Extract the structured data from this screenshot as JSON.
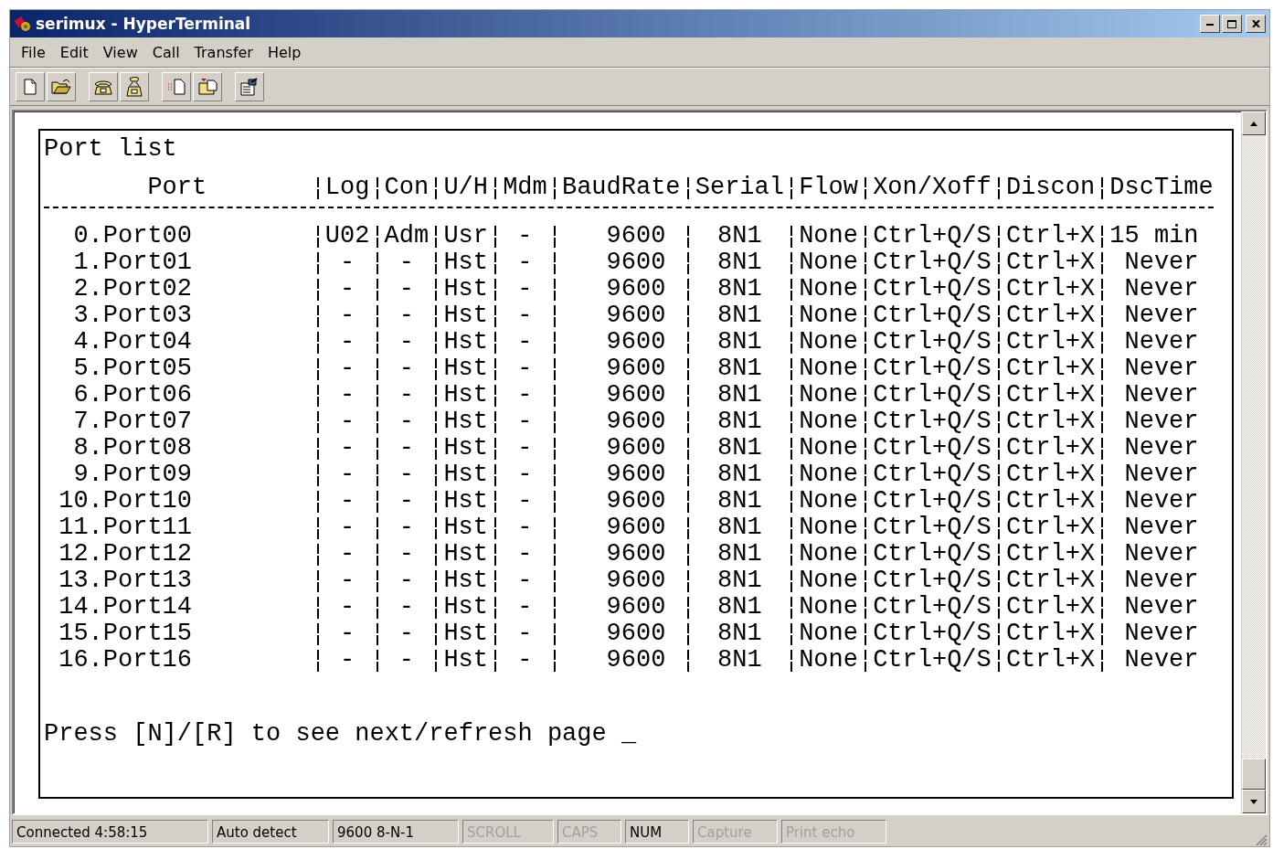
{
  "window": {
    "title": "serimux - HyperTerminal"
  },
  "menu": [
    "File",
    "Edit",
    "View",
    "Call",
    "Transfer",
    "Help"
  ],
  "terminal": {
    "title": "Port list",
    "columns": [
      "Port",
      "Log",
      "Con",
      "U/H",
      "Mdm",
      "BaudRate",
      "Serial",
      "Flow",
      "Xon/Xoff",
      "Discon",
      "DscTime"
    ],
    "rows": [
      [
        "0.Port00",
        "U02",
        "Adm",
        "Usr",
        "-",
        "9600",
        "8N1",
        "None",
        "Ctrl+Q/S",
        "Ctrl+X",
        "15 min"
      ],
      [
        "1.Port01",
        "-",
        "-",
        "Hst",
        "-",
        "9600",
        "8N1",
        "None",
        "Ctrl+Q/S",
        "Ctrl+X",
        "Never"
      ],
      [
        "2.Port02",
        "-",
        "-",
        "Hst",
        "-",
        "9600",
        "8N1",
        "None",
        "Ctrl+Q/S",
        "Ctrl+X",
        "Never"
      ],
      [
        "3.Port03",
        "-",
        "-",
        "Hst",
        "-",
        "9600",
        "8N1",
        "None",
        "Ctrl+Q/S",
        "Ctrl+X",
        "Never"
      ],
      [
        "4.Port04",
        "-",
        "-",
        "Hst",
        "-",
        "9600",
        "8N1",
        "None",
        "Ctrl+Q/S",
        "Ctrl+X",
        "Never"
      ],
      [
        "5.Port05",
        "-",
        "-",
        "Hst",
        "-",
        "9600",
        "8N1",
        "None",
        "Ctrl+Q/S",
        "Ctrl+X",
        "Never"
      ],
      [
        "6.Port06",
        "-",
        "-",
        "Hst",
        "-",
        "9600",
        "8N1",
        "None",
        "Ctrl+Q/S",
        "Ctrl+X",
        "Never"
      ],
      [
        "7.Port07",
        "-",
        "-",
        "Hst",
        "-",
        "9600",
        "8N1",
        "None",
        "Ctrl+Q/S",
        "Ctrl+X",
        "Never"
      ],
      [
        "8.Port08",
        "-",
        "-",
        "Hst",
        "-",
        "9600",
        "8N1",
        "None",
        "Ctrl+Q/S",
        "Ctrl+X",
        "Never"
      ],
      [
        "9.Port09",
        "-",
        "-",
        "Hst",
        "-",
        "9600",
        "8N1",
        "None",
        "Ctrl+Q/S",
        "Ctrl+X",
        "Never"
      ],
      [
        "10.Port10",
        "-",
        "-",
        "Hst",
        "-",
        "9600",
        "8N1",
        "None",
        "Ctrl+Q/S",
        "Ctrl+X",
        "Never"
      ],
      [
        "11.Port11",
        "-",
        "-",
        "Hst",
        "-",
        "9600",
        "8N1",
        "None",
        "Ctrl+Q/S",
        "Ctrl+X",
        "Never"
      ],
      [
        "12.Port12",
        "-",
        "-",
        "Hst",
        "-",
        "9600",
        "8N1",
        "None",
        "Ctrl+Q/S",
        "Ctrl+X",
        "Never"
      ],
      [
        "13.Port13",
        "-",
        "-",
        "Hst",
        "-",
        "9600",
        "8N1",
        "None",
        "Ctrl+Q/S",
        "Ctrl+X",
        "Never"
      ],
      [
        "14.Port14",
        "-",
        "-",
        "Hst",
        "-",
        "9600",
        "8N1",
        "None",
        "Ctrl+Q/S",
        "Ctrl+X",
        "Never"
      ],
      [
        "15.Port15",
        "-",
        "-",
        "Hst",
        "-",
        "9600",
        "8N1",
        "None",
        "Ctrl+Q/S",
        "Ctrl+X",
        "Never"
      ],
      [
        "16.Port16",
        "-",
        "-",
        "Hst",
        "-",
        "9600",
        "8N1",
        "None",
        "Ctrl+Q/S",
        "Ctrl+X",
        "Never"
      ]
    ],
    "prompt": "Press [N]/[R] to see next/refresh page",
    "cursor": "_"
  },
  "status_bar": [
    {
      "text": "Connected 4:58:15",
      "disabled": false
    },
    {
      "text": "Auto detect",
      "disabled": false
    },
    {
      "text": "9600 8-N-1",
      "disabled": false
    },
    {
      "text": "SCROLL",
      "disabled": true
    },
    {
      "text": "CAPS",
      "disabled": true
    },
    {
      "text": "NUM",
      "disabled": false
    },
    {
      "text": "Capture",
      "disabled": true
    },
    {
      "text": "Print echo",
      "disabled": true
    }
  ]
}
